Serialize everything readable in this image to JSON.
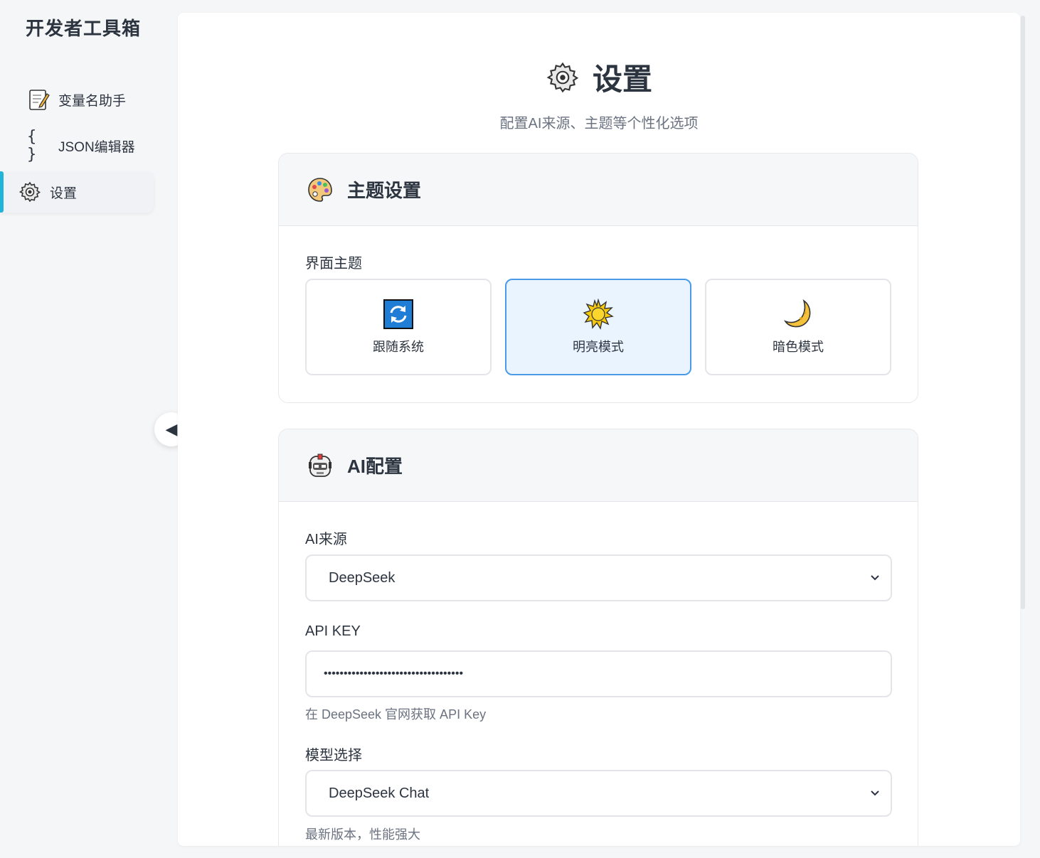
{
  "app": {
    "title": "开发者工具箱"
  },
  "sidebar": {
    "items": [
      {
        "label": "变量名助手",
        "icon": "memo-icon"
      },
      {
        "label": "JSON编辑器",
        "icon": "braces-icon"
      },
      {
        "label": "设置",
        "icon": "gear-icon",
        "active": true
      }
    ],
    "collapse_symbol": "◀"
  },
  "page": {
    "title": "设置",
    "subtitle": "配置AI来源、主题等个性化选项"
  },
  "theme_card": {
    "title": "主题设置",
    "field_label": "界面主题",
    "options": [
      {
        "label": "跟随系统",
        "icon": "sync-icon"
      },
      {
        "label": "明亮模式",
        "icon": "sun-icon",
        "selected": true
      },
      {
        "label": "暗色模式",
        "icon": "moon-icon"
      }
    ]
  },
  "ai_card": {
    "title": "AI配置",
    "source_label": "AI来源",
    "source_value": "DeepSeek",
    "api_key_label": "API KEY",
    "api_key_value": "•••••••••••••••••••••••••••••••••••",
    "api_key_hint": "在 DeepSeek 官网获取 API Key",
    "model_label": "模型选择",
    "model_value": "DeepSeek Chat",
    "model_hint": "最新版本，性能强大"
  },
  "colors": {
    "accent": "#1fb4d8",
    "selected_border": "#4a9ae8",
    "selected_bg": "#eaf4ff"
  }
}
